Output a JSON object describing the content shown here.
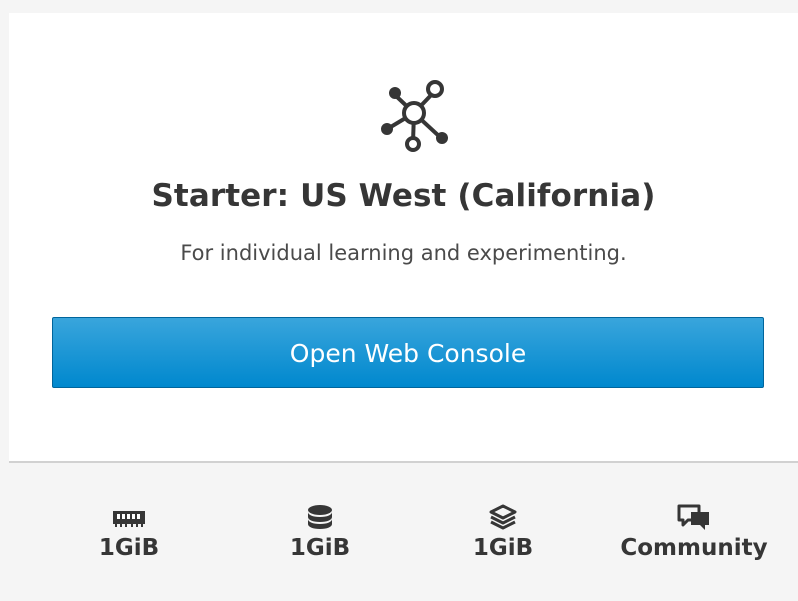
{
  "plan": {
    "title": "Starter: US West (California)",
    "description": "For individual learning and experimenting.",
    "hero_icon": "network-nodes-icon"
  },
  "actions": {
    "open_console_label": "Open Web Console"
  },
  "specs": [
    {
      "icon": "memory-icon",
      "value": "1GiB"
    },
    {
      "icon": "database-icon",
      "value": "1GiB"
    },
    {
      "icon": "layers-icon",
      "value": "1GiB"
    },
    {
      "icon": "comments-icon",
      "value": "Community"
    }
  ],
  "colors": {
    "button_top": "#39a5dc",
    "button_bottom": "#0088ce",
    "text": "#363636"
  }
}
